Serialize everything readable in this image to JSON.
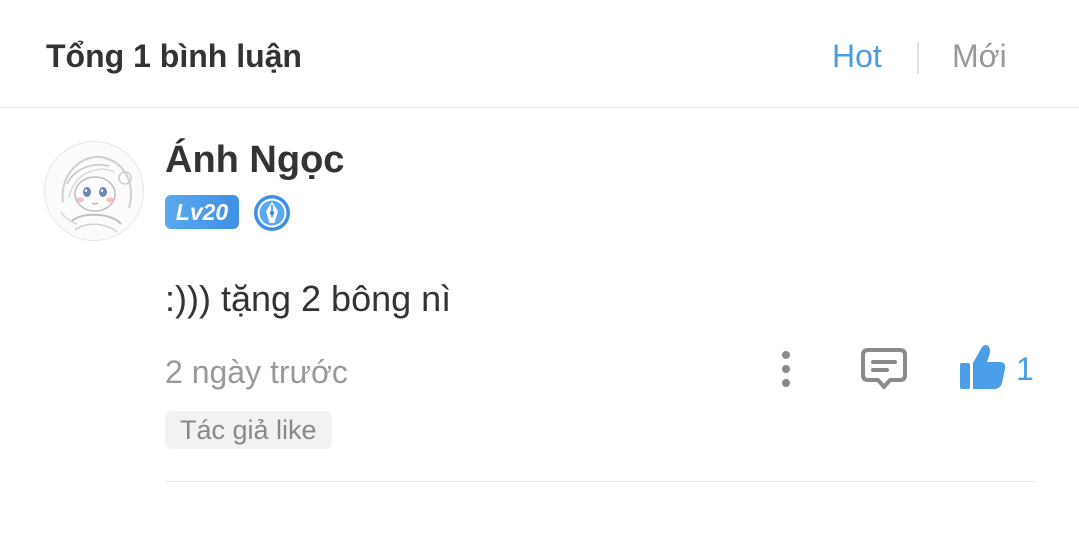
{
  "header": {
    "title": "Tổng 1 bình luận",
    "sort_options": [
      "Hot",
      "Mới"
    ],
    "active_sort": "Hot"
  },
  "comment": {
    "username": "Ánh Ngọc",
    "level": "Lv20",
    "badge_icon": "author-pen-badge-icon",
    "text": ":))) tặng 2 bông nì",
    "timestamp": "2 ngày trước",
    "like_count": "1",
    "author_like_tag": "Tác giả like"
  },
  "colors": {
    "accent": "#4a9ee8",
    "text_primary": "#333333",
    "text_secondary": "#999999",
    "tag_background": "#f2f2f2",
    "divider": "#e8e8e8"
  },
  "icons": {
    "more": "vertical-dots-icon",
    "reply": "comment-bubble-icon",
    "like": "thumbs-up-icon"
  }
}
